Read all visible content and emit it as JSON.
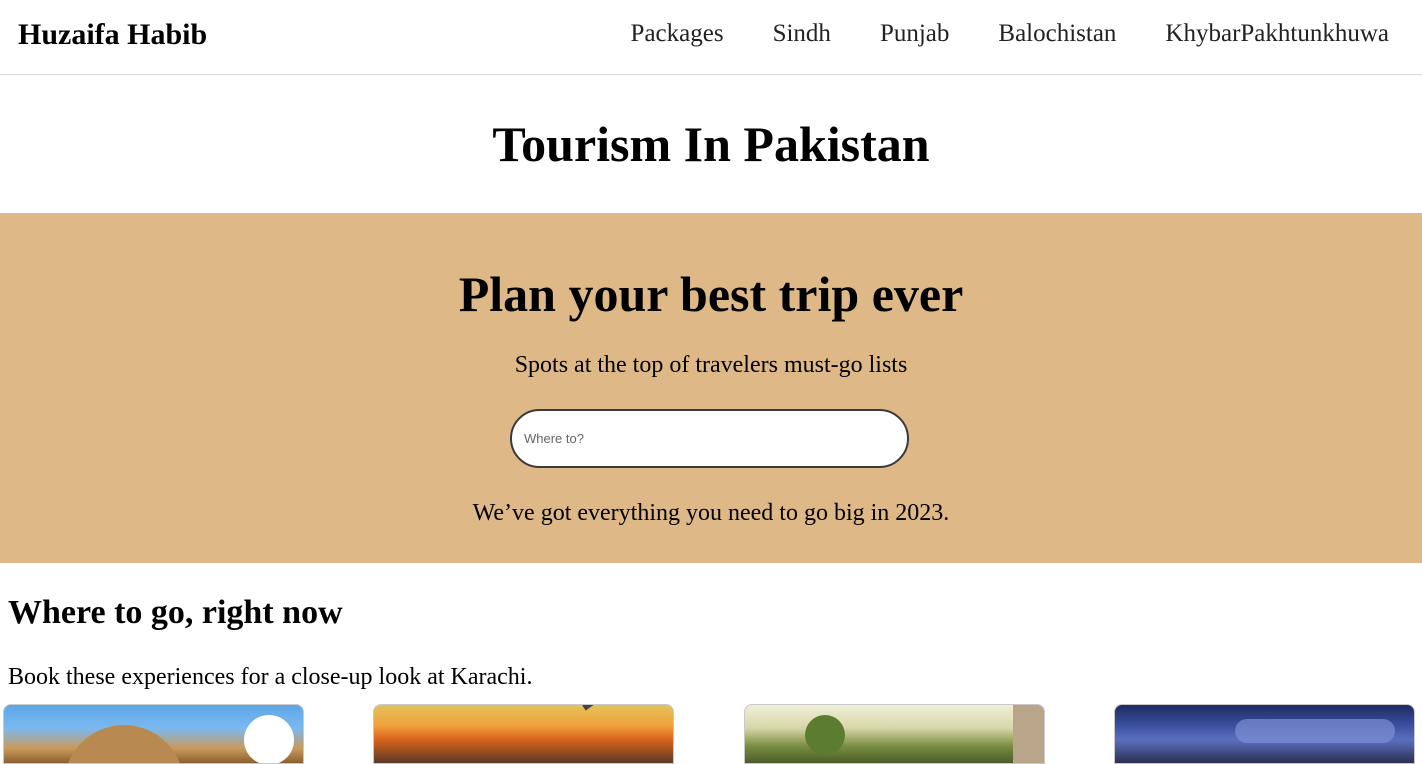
{
  "navbar": {
    "brand": "Huzaifa Habib",
    "links": [
      {
        "label": "Packages"
      },
      {
        "label": "Sindh"
      },
      {
        "label": "Punjab"
      },
      {
        "label": "Balochistan"
      },
      {
        "label": "KhybarPakhtunkhuwa"
      }
    ]
  },
  "page": {
    "title": "Tourism In Pakistan"
  },
  "hero": {
    "heading": "Plan your best trip ever",
    "subtitle": "Spots at the top of travelers must-go lists",
    "search": {
      "placeholder": "Where to?",
      "value": ""
    },
    "tagline": "We’ve got everything you need to go big in 2023.",
    "background_color": "#deb887"
  },
  "section": {
    "heading": "Where to go, right now",
    "subtitle": "Book these experiences for a close-up look at Karachi."
  },
  "cards": [
    {
      "icon": "domed-building-photo"
    },
    {
      "icon": "grilling-flames-photo"
    },
    {
      "icon": "palm-tree-street-photo"
    },
    {
      "icon": "night-sky-photo"
    }
  ]
}
